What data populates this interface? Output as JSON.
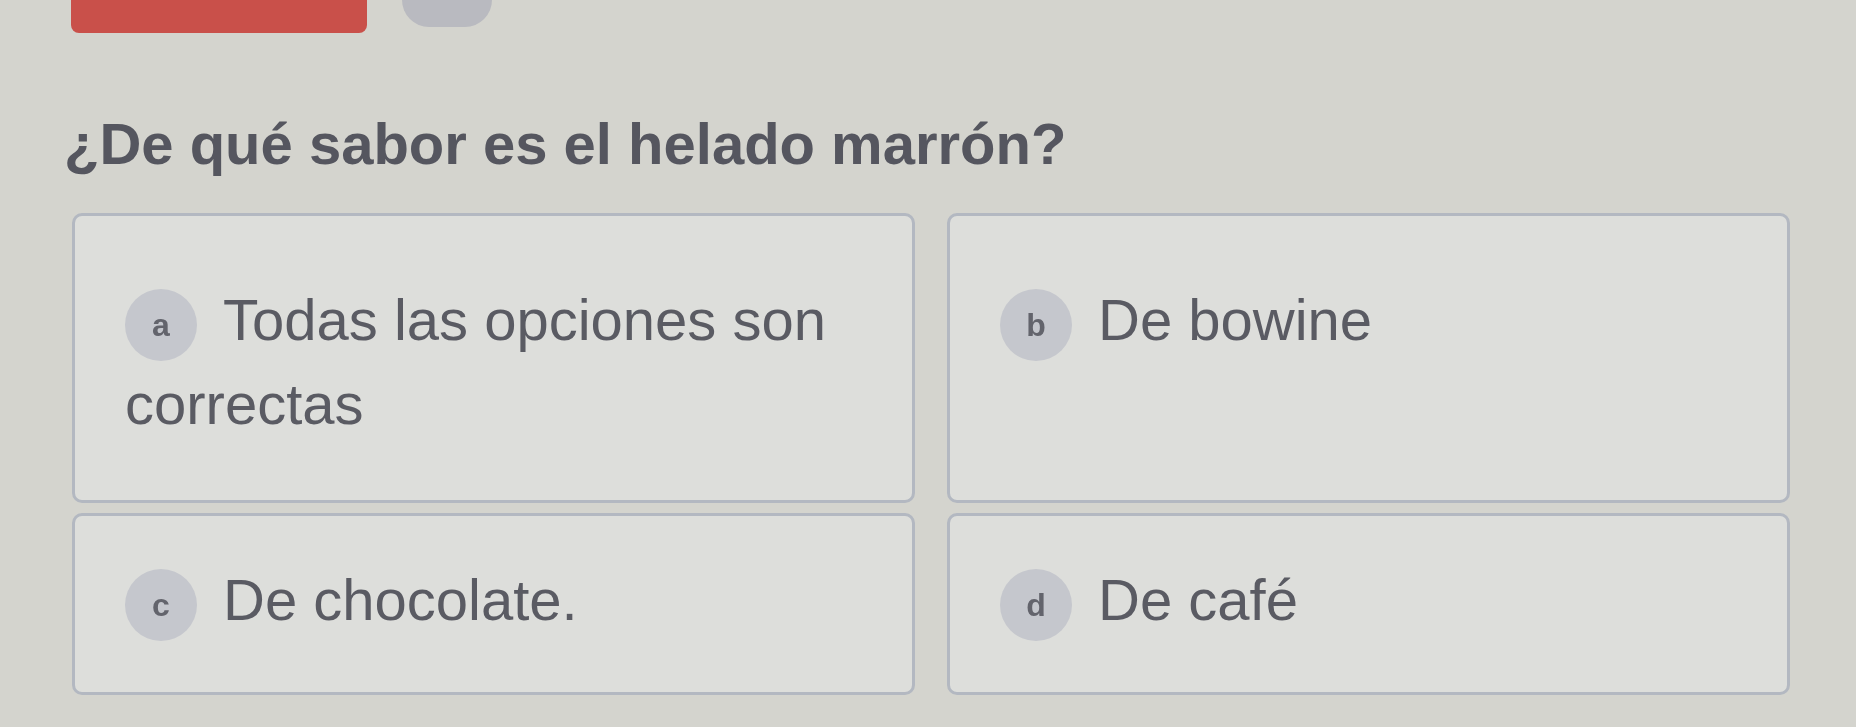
{
  "question": "¿De qué sabor es el helado marrón?",
  "options": [
    {
      "letter": "a",
      "text": "Todas las opciones son correctas",
      "selected": false
    },
    {
      "letter": "b",
      "text": "De bowine",
      "selected": false
    },
    {
      "letter": "c",
      "text": "De chocolate.",
      "selected": false
    },
    {
      "letter": "d",
      "text": "De café",
      "selected": false
    }
  ]
}
